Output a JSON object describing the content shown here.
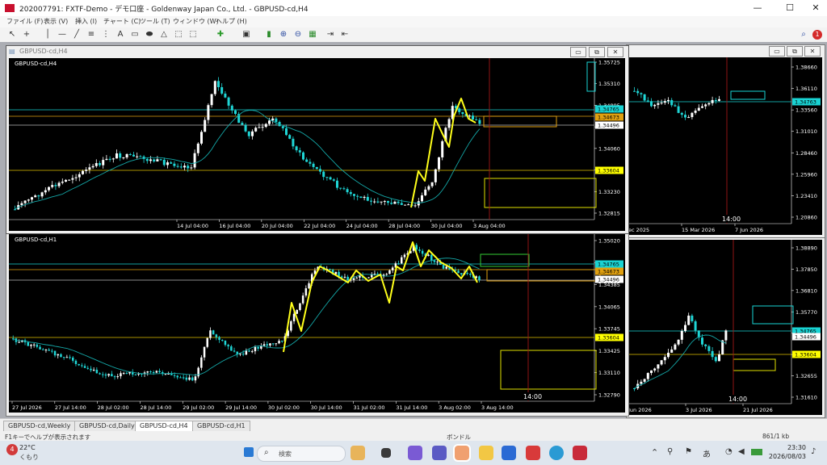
{
  "app": {
    "title": "202007791: FXTF-Demo - デモ口座 - Goldenway Japan Co., Ltd. - GBPUSD-cd,H4",
    "menu": [
      "ファイル (F)",
      "表示 (V)",
      "挿入 (I)",
      "チャート (C)",
      "ツール (T)",
      "ウィンドウ (W)",
      "ヘルプ (H)"
    ],
    "notification_count": "1"
  },
  "colors": {
    "chart_bg": "#000000",
    "bull": "#ffffff",
    "bear": "#1fd6d6",
    "ma": "#14a7a7",
    "zigzag": "#ffff1a",
    "vline": "#a01818"
  },
  "windows": {
    "h4": {
      "caption": "GBPUSD-cd,H4",
      "label": "GBPUSD-cd,H4",
      "prices": [
        "1.35725",
        "1.35310",
        "1.34895",
        "1.34480",
        "1.34060",
        "1.33645",
        "1.33230",
        "1.32815"
      ],
      "price_tags": [
        {
          "text": "1.34765",
          "bg": "#19d3d3",
          "fg": "#000"
        },
        {
          "text": "1.34673",
          "bg": "#e0a010",
          "fg": "#000"
        },
        {
          "text": "1.34496",
          "bg": "#ffffff",
          "fg": "#000"
        },
        {
          "text": "1.33604",
          "bg": "#ffff00",
          "fg": "#000"
        }
      ],
      "times": [
        "14 Jul 04:00",
        "16 Jul 04:00",
        "20 Jul 04:00",
        "22 Jul 04:00",
        "24 Jul 04:00",
        "28 Jul 04:00",
        "30 Jul 04:00",
        "3 Aug 04:00"
      ]
    },
    "h1": {
      "label": "GBPUSD-cd,H1",
      "prices": [
        "1.35020",
        "1.34705",
        "1.34385",
        "1.34065",
        "1.33745",
        "1.33425",
        "1.33110",
        "1.32790"
      ],
      "price_tags": [
        {
          "text": "1.34765",
          "bg": "#19d3d3",
          "fg": "#000"
        },
        {
          "text": "1.34673",
          "bg": "#e0a010",
          "fg": "#000"
        },
        {
          "text": "1.34496",
          "bg": "#ffffff",
          "fg": "#000"
        },
        {
          "text": "1.33604",
          "bg": "#ffff00",
          "fg": "#000"
        }
      ],
      "times": [
        "27 Jul 2026",
        "27 Jul 14:00",
        "28 Jul 02:00",
        "28 Jul 14:00",
        "29 Jul 02:00",
        "29 Jul 14:00",
        "30 Jul 02:00",
        "30 Jul 14:00",
        "31 Jul 02:00",
        "31 Jul 14:00",
        "3 Aug 02:00",
        "3 Aug 14:00"
      ],
      "time_marker": "14:00"
    },
    "weekly": {
      "prices": [
        "1.38660",
        "1.36110",
        "1.33560",
        "1.31010",
        "1.28460",
        "1.25960",
        "1.23410",
        "1.20860"
      ],
      "price_tags": [
        {
          "text": "1.34763",
          "bg": "#19d3d3",
          "fg": "#000"
        }
      ],
      "times": [
        "ec 2025",
        "15 Mar 2026",
        "7 Jun 2026"
      ],
      "time_marker": "14:00"
    },
    "daily": {
      "prices": [
        "1.38890",
        "1.37850",
        "1.36810",
        "1.35770",
        "1.34735",
        "1.33695",
        "1.32655",
        "1.31610"
      ],
      "price_tags": [
        {
          "text": "1.34765",
          "bg": "#19d3d3",
          "fg": "#000"
        },
        {
          "text": "1.34496",
          "bg": "#ffffff",
          "fg": "#000"
        },
        {
          "text": "1.33604",
          "bg": "#ffff00",
          "fg": "#000"
        }
      ],
      "times": [
        "Jun 2026",
        "3 Jul 2026",
        "21 Jul 2026"
      ],
      "time_marker": "14:00"
    }
  },
  "tabs": [
    "GBPUSD-cd,Weekly",
    "GBPUSD-cd,Daily",
    "GBPUSD-cd,H4",
    "GBPUSD-cd,H1"
  ],
  "active_tab": "GBPUSD-cd,H4",
  "status": {
    "help": "F1キーでヘルプが表示されます",
    "mode": "ボンドル",
    "traffic": "861/1 kb"
  },
  "taskbar": {
    "weather_temp": "22°C",
    "weather_desc": "くもり",
    "weather_badge": "4",
    "search_label": "検索",
    "clock_time": "23:30",
    "clock_date": "2026/08/03"
  }
}
